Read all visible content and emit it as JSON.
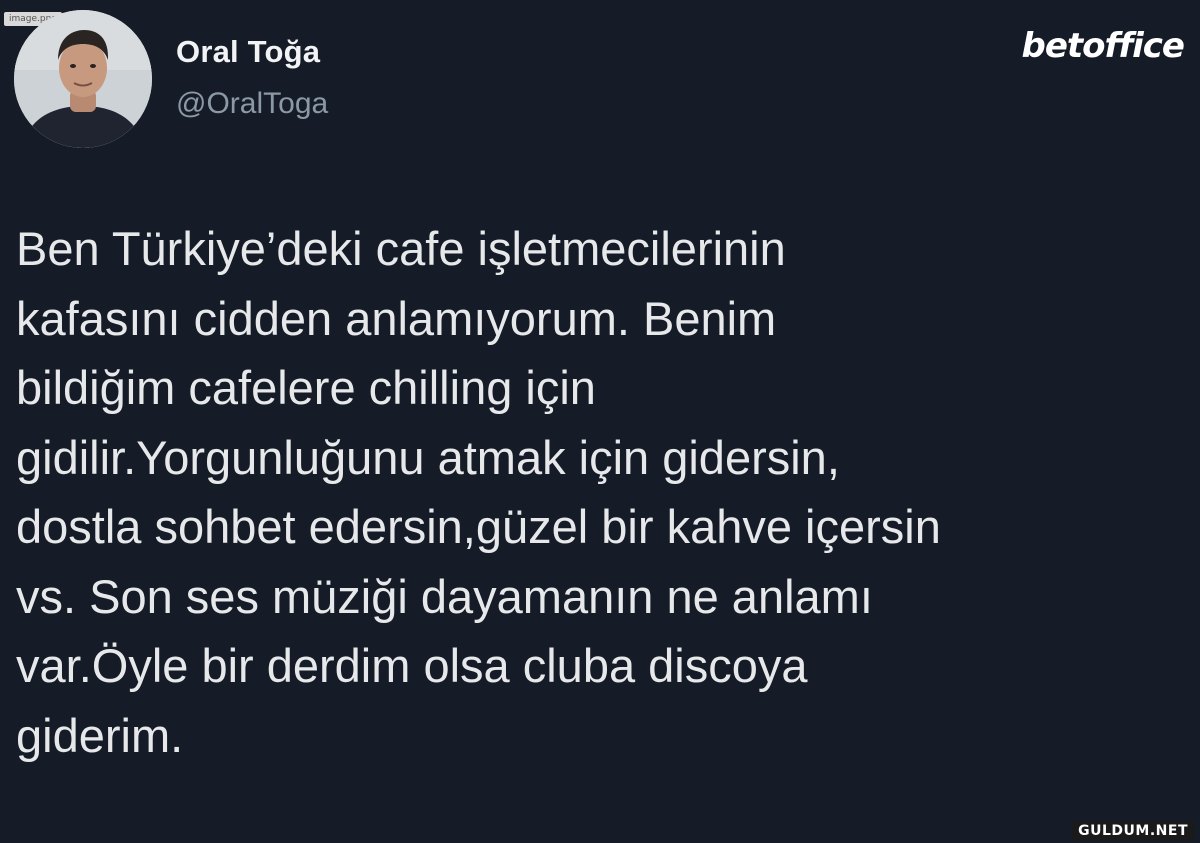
{
  "file_label": "image.png",
  "author": {
    "display_name": "Oral Toğa",
    "handle": "@OralToga"
  },
  "brand_logo": "betoffice",
  "tweet": {
    "lines": [
      "Ben Türkiye’deki cafe işletmecilerinin",
      "kafasını cidden anlamıyorum. Benim",
      "bildiğim cafelere chilling için",
      "gidilir.Yorgunluğunu atmak için gidersin,",
      "dostla sohbet edersin,güzel bir kahve içersin",
      "vs. Son ses müziği dayamanın ne anlamı",
      "var.Öyle bir derdim olsa cluba discoya",
      "giderim."
    ]
  },
  "watermark": "GULDUM.NET"
}
